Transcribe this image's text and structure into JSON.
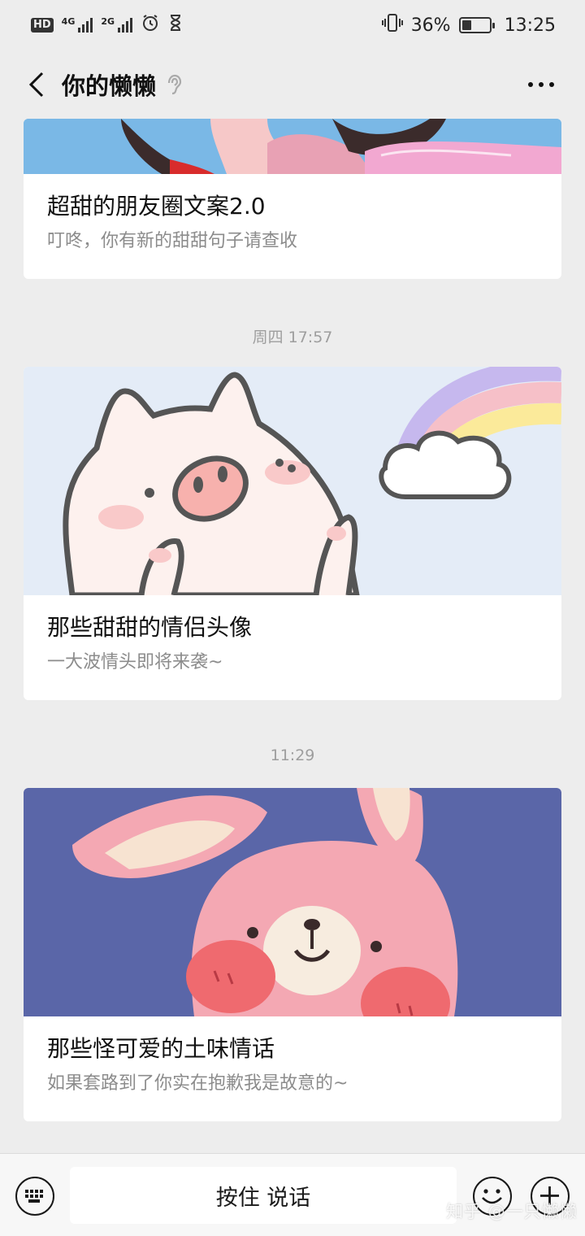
{
  "status_bar": {
    "hd": "HD",
    "net1": "4G",
    "net2": "2G",
    "battery_percent": "36%",
    "battery_level": 0.36,
    "time": "13:25"
  },
  "header": {
    "title": "你的懒懒"
  },
  "chat": {
    "items": [
      {
        "title": "超甜的朋友圈文案2.0",
        "subtitle": "叮咚，你有新的甜甜句子请查收"
      },
      {
        "time": "周四 17:57",
        "title": "那些甜甜的情侣头像",
        "subtitle": "一大波情头即将来袭~"
      },
      {
        "time": "11:29",
        "title": "那些怪可爱的土味情话",
        "subtitle": "如果套路到了你实在抱歉我是故意的~"
      }
    ]
  },
  "bottom_bar": {
    "talk_label": "按住 说话"
  },
  "watermark": "知乎 @一只懒懒",
  "colors": {
    "background": "#ededed",
    "card": "#ffffff",
    "subtitle": "#8c8c8c"
  }
}
